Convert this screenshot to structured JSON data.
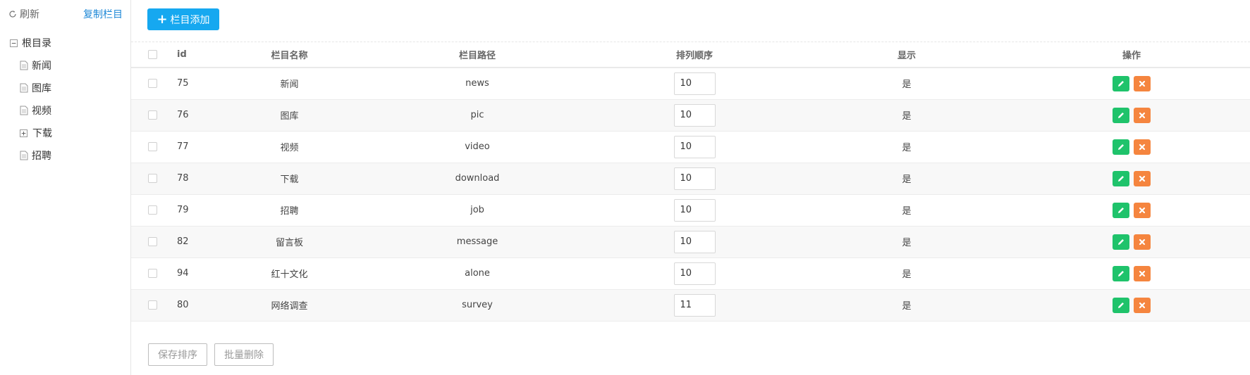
{
  "colors": {
    "primary": "#16a8f0",
    "edit": "#1fc36b",
    "delete": "#f5853f",
    "link": "#1e88d7"
  },
  "sidebar": {
    "refresh_label": "刷新",
    "copy_label": "复制栏目",
    "root_label": "根目录",
    "items": [
      {
        "label": "新闻",
        "icon": "doc-icon"
      },
      {
        "label": "图库",
        "icon": "doc-icon"
      },
      {
        "label": "视频",
        "icon": "doc-icon"
      },
      {
        "label": "下载",
        "icon": "expand-plus-icon"
      },
      {
        "label": "招聘",
        "icon": "doc-icon"
      }
    ]
  },
  "toolbar": {
    "add_label": "栏目添加"
  },
  "table": {
    "headers": {
      "id": "id",
      "name": "栏目名称",
      "path": "栏目路径",
      "order": "排列顺序",
      "display": "显示",
      "actions": "操作"
    },
    "rows": [
      {
        "id": "75",
        "name": "新闻",
        "path": "news",
        "order": "10",
        "display": "是"
      },
      {
        "id": "76",
        "name": "图库",
        "path": "pic",
        "order": "10",
        "display": "是"
      },
      {
        "id": "77",
        "name": "视频",
        "path": "video",
        "order": "10",
        "display": "是"
      },
      {
        "id": "78",
        "name": "下载",
        "path": "download",
        "order": "10",
        "display": "是"
      },
      {
        "id": "79",
        "name": "招聘",
        "path": "job",
        "order": "10",
        "display": "是"
      },
      {
        "id": "82",
        "name": "留言板",
        "path": "message",
        "order": "10",
        "display": "是"
      },
      {
        "id": "94",
        "name": "红十文化",
        "path": "alone",
        "order": "10",
        "display": "是"
      },
      {
        "id": "80",
        "name": "网络调查",
        "path": "survey",
        "order": "11",
        "display": "是"
      }
    ]
  },
  "footer": {
    "save_order_label": "保存排序",
    "batch_delete_label": "批量删除"
  }
}
